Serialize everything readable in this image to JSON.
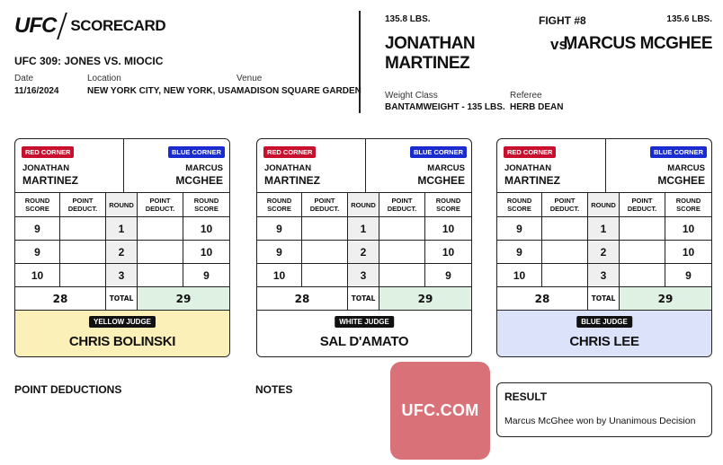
{
  "header": {
    "logo_text": "UFC",
    "title": "SCORECARD",
    "event": "UFC 309: JONES VS. MIOCIC",
    "date_label": "Date",
    "date": "11/16/2024",
    "location_label": "Location",
    "location": "NEW YORK CITY, NEW YORK, USA",
    "venue_label": "Venue",
    "venue": "MADISON SQUARE GARDEN"
  },
  "fight": {
    "red_weight": "135.8 LBS.",
    "red_name_line1": "JONATHAN",
    "red_name_line2": "MARTINEZ",
    "fight_number": "FIGHT #8",
    "vs": "vs.",
    "blue_weight": "135.6 LBS.",
    "blue_name": "MARCUS MCGHEE",
    "weight_class_label": "Weight Class",
    "weight_class": "BANTAMWEIGHT - 135 LBS.",
    "referee_label": "Referee",
    "referee": "HERB DEAN"
  },
  "card_labels": {
    "red_corner": "RED CORNER",
    "blue_corner": "BLUE CORNER",
    "red_first": "JONATHAN",
    "red_last": "MARTINEZ",
    "blue_first": "MARCUS",
    "blue_last": "MCGHEE",
    "round_score": "ROUND SCORE",
    "point_deduct": "POINT DEDUCT.",
    "round": "ROUND",
    "total": "TOTAL"
  },
  "judges": [
    {
      "badge": "YELLOW JUDGE",
      "name": "CHRIS BOLINSKI",
      "color": "#fbf0b8",
      "rounds": [
        {
          "red_score": "9",
          "red_deduct": "",
          "round": "1",
          "blue_deduct": "",
          "blue_score": "10"
        },
        {
          "red_score": "9",
          "red_deduct": "",
          "round": "2",
          "blue_deduct": "",
          "blue_score": "10"
        },
        {
          "red_score": "10",
          "red_deduct": "",
          "round": "3",
          "blue_deduct": "",
          "blue_score": "9"
        }
      ],
      "red_total": "28",
      "blue_total": "29"
    },
    {
      "badge": "WHITE JUDGE",
      "name": "SAL D'AMATO",
      "color": "#ffffff",
      "rounds": [
        {
          "red_score": "9",
          "red_deduct": "",
          "round": "1",
          "blue_deduct": "",
          "blue_score": "10"
        },
        {
          "red_score": "9",
          "red_deduct": "",
          "round": "2",
          "blue_deduct": "",
          "blue_score": "10"
        },
        {
          "red_score": "10",
          "red_deduct": "",
          "round": "3",
          "blue_deduct": "",
          "blue_score": "9"
        }
      ],
      "red_total": "28",
      "blue_total": "29"
    },
    {
      "badge": "BLUE JUDGE",
      "name": "CHRIS LEE",
      "color": "#dde2fb",
      "rounds": [
        {
          "red_score": "9",
          "red_deduct": "",
          "round": "1",
          "blue_deduct": "",
          "blue_score": "10"
        },
        {
          "red_score": "9",
          "red_deduct": "",
          "round": "2",
          "blue_deduct": "",
          "blue_score": "10"
        },
        {
          "red_score": "10",
          "red_deduct": "",
          "round": "3",
          "blue_deduct": "",
          "blue_score": "9"
        }
      ],
      "red_total": "28",
      "blue_total": "29"
    }
  ],
  "footer": {
    "point_deductions_label": "POINT DEDUCTIONS",
    "notes_label": "NOTES",
    "ufc_com": "UFC.COM",
    "result_label": "RESULT",
    "result_text": "Marcus McGhee won by Unanimous Decision"
  },
  "colors": {
    "red_corner": "#c8102e",
    "blue_corner": "#1a2bcf",
    "winner_total_bg": "#dff1e2",
    "ufc_box": "#d97178"
  }
}
